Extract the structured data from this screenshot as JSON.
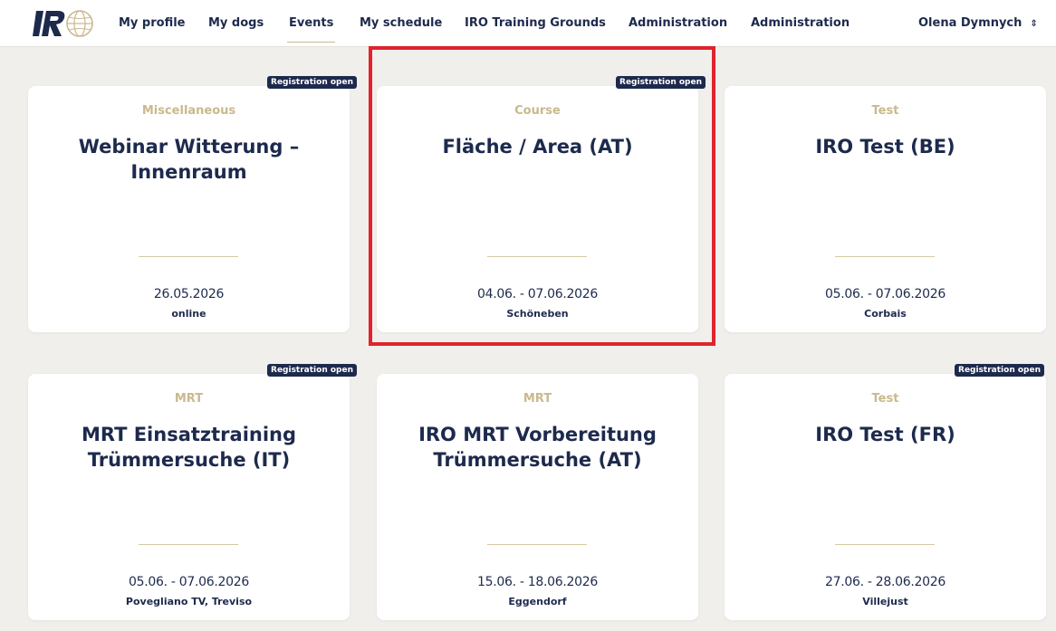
{
  "nav": {
    "items": [
      {
        "label": "My profile"
      },
      {
        "label": "My dogs"
      },
      {
        "label": "Events"
      },
      {
        "label": "My schedule"
      },
      {
        "label": "IRO Training Grounds"
      },
      {
        "label": "Administration"
      },
      {
        "label": "Administration"
      }
    ],
    "active_item": "Events",
    "user_name": "Olena Dymnych"
  },
  "colors": {
    "navy": "#1d2a4d",
    "gold": "#c9b98d",
    "background": "#f1efec",
    "highlight": "#e0232c"
  },
  "badge_label": "Registration open",
  "events": [
    {
      "category": "Miscellaneous",
      "title": "Webinar Witterung – Innenraum",
      "date": "26.05.2026",
      "location": "online",
      "registration_open": true
    },
    {
      "category": "Course",
      "title": "Fläche / Area (AT)",
      "date": "04.06. - 07.06.2026",
      "location": "Schöneben",
      "registration_open": true,
      "highlighted": true
    },
    {
      "category": "Test",
      "title": "IRO Test (BE)",
      "date": "05.06. - 07.06.2026",
      "location": "Corbais",
      "registration_open": false
    },
    {
      "category": "MRT",
      "title": "MRT Einsatztraining Trümmersuche (IT)",
      "date": "05.06. - 07.06.2026",
      "location": "Povegliano TV, Treviso",
      "registration_open": true
    },
    {
      "category": "MRT",
      "title": "IRO MRT Vorbereitung Trümmersuche (AT)",
      "date": "15.06. - 18.06.2026",
      "location": "Eggendorf",
      "registration_open": false
    },
    {
      "category": "Test",
      "title": "IRO Test (FR)",
      "date": "27.06. - 28.06.2026",
      "location": "Villejust",
      "registration_open": true
    }
  ]
}
